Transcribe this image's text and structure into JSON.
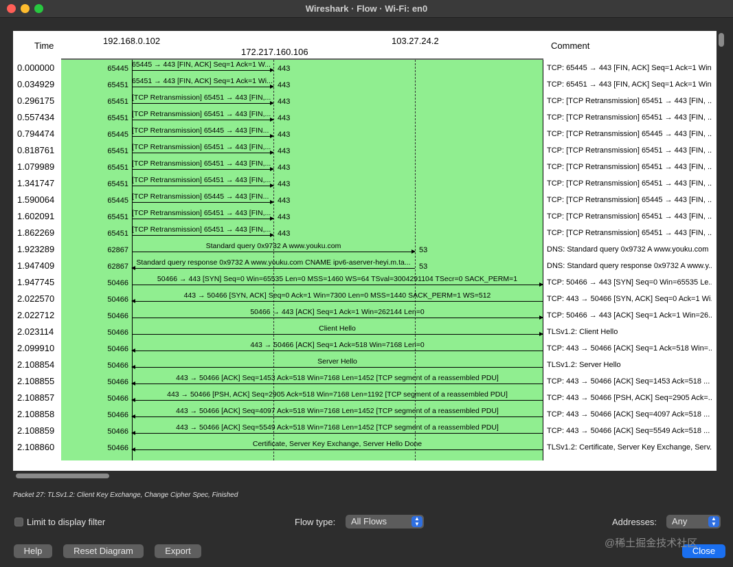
{
  "window": {
    "title": "Wireshark · Flow · Wi-Fi: en0"
  },
  "headers": {
    "time": "Time",
    "host1": "192.168.0.102",
    "host2": "172.217.160.106",
    "host3": "103.27.24.2",
    "comment": "Comment"
  },
  "rows": [
    {
      "time": "0.000000",
      "port": "65445",
      "dst": "host2",
      "dir": "right",
      "dport": "443",
      "msg": "65445 → 443 [FIN, ACK] Seq=1 Ack=1 W...",
      "comment": "TCP: 65445 → 443 [FIN, ACK] Seq=1 Ack=1 Win..."
    },
    {
      "time": "0.034929",
      "port": "65451",
      "dst": "host2",
      "dir": "right",
      "dport": "443",
      "msg": "65451 → 443 [FIN, ACK] Seq=1 Ack=1 Wi...",
      "comment": "TCP: 65451 → 443 [FIN, ACK] Seq=1 Ack=1 Win..."
    },
    {
      "time": "0.296175",
      "port": "65451",
      "dst": "host2",
      "dir": "right",
      "dport": "443",
      "msg": "[TCP Retransmission] 65451 → 443 [FIN,...",
      "comment": "TCP: [TCP Retransmission] 65451 → 443 [FIN, ..."
    },
    {
      "time": "0.557434",
      "port": "65451",
      "dst": "host2",
      "dir": "right",
      "dport": "443",
      "msg": "[TCP Retransmission] 65451 → 443 [FIN,...",
      "comment": "TCP: [TCP Retransmission] 65451 → 443 [FIN, ..."
    },
    {
      "time": "0.794474",
      "port": "65445",
      "dst": "host2",
      "dir": "right",
      "dport": "443",
      "msg": "[TCP Retransmission] 65445 → 443 [FIN...",
      "comment": "TCP: [TCP Retransmission] 65445 → 443 [FIN, ..."
    },
    {
      "time": "0.818761",
      "port": "65451",
      "dst": "host2",
      "dir": "right",
      "dport": "443",
      "msg": "[TCP Retransmission] 65451 → 443 [FIN,...",
      "comment": "TCP: [TCP Retransmission] 65451 → 443 [FIN, ..."
    },
    {
      "time": "1.079989",
      "port": "65451",
      "dst": "host2",
      "dir": "right",
      "dport": "443",
      "msg": "[TCP Retransmission] 65451 → 443 [FIN,...",
      "comment": "TCP: [TCP Retransmission] 65451 → 443 [FIN, ..."
    },
    {
      "time": "1.341747",
      "port": "65451",
      "dst": "host2",
      "dir": "right",
      "dport": "443",
      "msg": "[TCP Retransmission] 65451 → 443 [FIN,...",
      "comment": "TCP: [TCP Retransmission] 65451 → 443 [FIN, ..."
    },
    {
      "time": "1.590064",
      "port": "65445",
      "dst": "host2",
      "dir": "right",
      "dport": "443",
      "msg": "[TCP Retransmission] 65445 → 443 [FIN...",
      "comment": "TCP: [TCP Retransmission] 65445 → 443 [FIN, ..."
    },
    {
      "time": "1.602091",
      "port": "65451",
      "dst": "host2",
      "dir": "right",
      "dport": "443",
      "msg": "[TCP Retransmission] 65451 → 443 [FIN,...",
      "comment": "TCP: [TCP Retransmission] 65451 → 443 [FIN, ..."
    },
    {
      "time": "1.862269",
      "port": "65451",
      "dst": "host2",
      "dir": "right",
      "dport": "443",
      "msg": "[TCP Retransmission] 65451 → 443 [FIN,...",
      "comment": "TCP: [TCP Retransmission] 65451 → 443 [FIN, ..."
    },
    {
      "time": "1.923289",
      "port": "62867",
      "dst": "host3",
      "dir": "right",
      "dport": "53",
      "msg": "Standard query 0x9732 A www.youku.com",
      "comment": "DNS: Standard query 0x9732 A www.youku.com"
    },
    {
      "time": "1.947409",
      "port": "62867",
      "dst": "host3",
      "dir": "left",
      "dport": "53",
      "msg": "Standard query response 0x9732 A www.youku.com CNAME ipv6-aserver-heyi.m.ta...",
      "comment": "DNS: Standard query response 0x9732 A www.y..."
    },
    {
      "time": "1.947745",
      "port": "50466",
      "dst": "host4",
      "dir": "right",
      "dport": "",
      "msg": "50466 → 443 [SYN] Seq=0 Win=65535 Len=0 MSS=1460 WS=64 TSval=3004291104 TSecr=0 SACK_PERM=1",
      "comment": "TCP: 50466 → 443 [SYN] Seq=0 Win=65535 Le..."
    },
    {
      "time": "2.022570",
      "port": "50466",
      "dst": "host4",
      "dir": "left",
      "dport": "",
      "msg": "443 → 50466 [SYN, ACK] Seq=0 Ack=1 Win=7300 Len=0 MSS=1440 SACK_PERM=1 WS=512",
      "comment": "TCP: 443 → 50466 [SYN, ACK] Seq=0 Ack=1 Wi..."
    },
    {
      "time": "2.022712",
      "port": "50466",
      "dst": "host4",
      "dir": "right",
      "dport": "",
      "msg": "50466 → 443 [ACK] Seq=1 Ack=1 Win=262144 Len=0",
      "comment": "TCP: 50466 → 443 [ACK] Seq=1 Ack=1 Win=26..."
    },
    {
      "time": "2.023114",
      "port": "50466",
      "dst": "host4",
      "dir": "right",
      "dport": "",
      "msg": "Client Hello",
      "comment": "TLSv1.2: Client Hello"
    },
    {
      "time": "2.099910",
      "port": "50466",
      "dst": "host4",
      "dir": "left",
      "dport": "",
      "msg": "443 → 50466 [ACK] Seq=1 Ack=518 Win=7168 Len=0",
      "comment": "TCP: 443 → 50466 [ACK] Seq=1 Ack=518 Win=..."
    },
    {
      "time": "2.108854",
      "port": "50466",
      "dst": "host4",
      "dir": "left",
      "dport": "",
      "msg": "Server Hello",
      "comment": "TLSv1.2: Server Hello"
    },
    {
      "time": "2.108855",
      "port": "50466",
      "dst": "host4",
      "dir": "left",
      "dport": "",
      "msg": "443 → 50466 [ACK] Seq=1453 Ack=518 Win=7168 Len=1452 [TCP segment of a reassembled PDU]",
      "comment": "TCP: 443 → 50466 [ACK] Seq=1453 Ack=518 ..."
    },
    {
      "time": "2.108857",
      "port": "50466",
      "dst": "host4",
      "dir": "left",
      "dport": "",
      "msg": "443 → 50466 [PSH, ACK] Seq=2905 Ack=518 Win=7168 Len=1192 [TCP segment of a reassembled PDU]",
      "comment": "TCP: 443 → 50466 [PSH, ACK] Seq=2905 Ack=..."
    },
    {
      "time": "2.108858",
      "port": "50466",
      "dst": "host4",
      "dir": "left",
      "dport": "",
      "msg": "443 → 50466 [ACK] Seq=4097 Ack=518 Win=7168 Len=1452 [TCP segment of a reassembled PDU]",
      "comment": "TCP: 443 → 50466 [ACK] Seq=4097 Ack=518 ..."
    },
    {
      "time": "2.108859",
      "port": "50466",
      "dst": "host4",
      "dir": "left",
      "dport": "",
      "msg": "443 → 50466 [ACK] Seq=5549 Ack=518 Win=7168 Len=1452 [TCP segment of a reassembled PDU]",
      "comment": "TCP: 443 → 50466 [ACK] Seq=5549 Ack=518 ..."
    },
    {
      "time": "2.108860",
      "port": "50466",
      "dst": "host4",
      "dir": "left",
      "dport": "",
      "msg": "Certificate, Server Key Exchange, Server Hello Done",
      "comment": "TLSv1.2: Certificate, Server Key Exchange, Serv..."
    }
  ],
  "status": {
    "text": "Packet 27: TLSv1.2: Client Key Exchange, Change Cipher Spec, Finished"
  },
  "controls": {
    "limit_label": "Limit to display filter",
    "limit_checked": false,
    "flow_type_label": "Flow type:",
    "flow_type_value": "All Flows",
    "addresses_label": "Addresses:",
    "addresses_value": "Any"
  },
  "buttons": {
    "help": "Help",
    "reset": "Reset Diagram",
    "export": "Export",
    "close": "Close"
  },
  "watermark": "@稀土掘金技术社区"
}
